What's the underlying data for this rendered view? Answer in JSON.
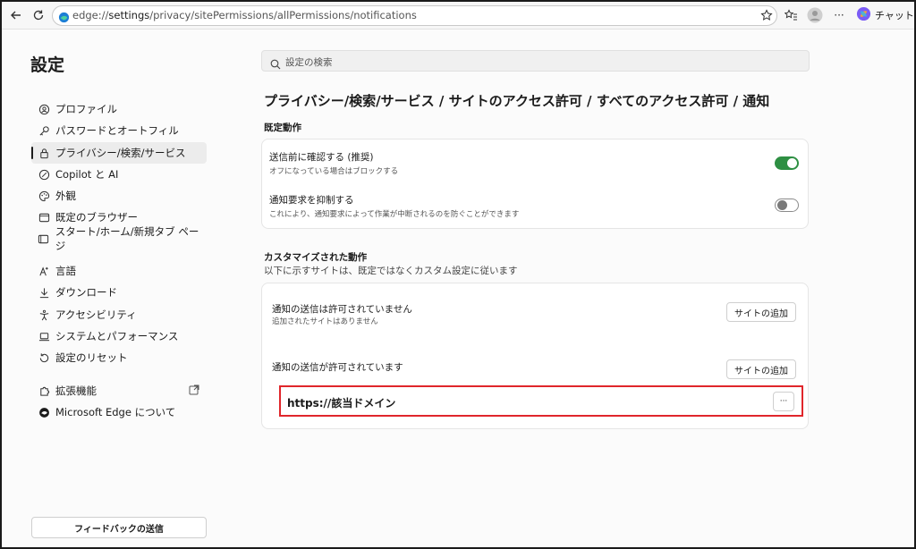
{
  "browser": {
    "url_prefix": "edge://",
    "url_host": "settings",
    "url_path": "/privacy/sitePermissions/allPermissions/notifications",
    "chat_label": "チャット"
  },
  "sidebar": {
    "title": "設定",
    "items": [
      {
        "label": "プロファイル",
        "icon": "profile-icon"
      },
      {
        "label": "パスワードとオートフィル",
        "icon": "key-icon"
      },
      {
        "label": "プライバシー/検索/サービス",
        "icon": "lock-icon",
        "active": true
      },
      {
        "label": "Copilot と AI",
        "icon": "copilot-icon"
      },
      {
        "label": "外観",
        "icon": "palette-icon"
      },
      {
        "label": "既定のブラウザー",
        "icon": "browser-icon"
      },
      {
        "label": "スタート/ホーム/新規タブ ページ",
        "icon": "home-icon"
      },
      {
        "label": "言語",
        "icon": "language-icon"
      },
      {
        "label": "ダウンロード",
        "icon": "download-icon"
      },
      {
        "label": "アクセシビリティ",
        "icon": "accessibility-icon"
      },
      {
        "label": "システムとパフォーマンス",
        "icon": "laptop-icon"
      },
      {
        "label": "設定のリセット",
        "icon": "reset-icon"
      },
      {
        "label": "拡張機能",
        "icon": "puzzle-icon"
      },
      {
        "label": "Microsoft Edge について",
        "icon": "edge-icon"
      }
    ],
    "feedback_label": "フィードバックの送信"
  },
  "search": {
    "placeholder": "設定の検索"
  },
  "breadcrumb": "プライバシー/検索/サービス / サイトのアクセス許可 / すべてのアクセス許可 / 通知",
  "default_behavior": {
    "title": "既定動作",
    "rows": [
      {
        "title": "送信前に確認する (推奨)",
        "desc": "オフになっている場合はブロックする",
        "toggle": "on"
      },
      {
        "title": "通知要求を抑制する",
        "desc": "これにより、通知要求によって作業が中断されるのを防ぐことができます",
        "toggle": "off"
      }
    ]
  },
  "custom_behavior": {
    "title": "カスタマイズされた動作",
    "subtitle": "以下に示すサイトは、既定ではなくカスタム設定に従います",
    "blocked": {
      "title": "通知の送信は許可されていません",
      "desc": "追加されたサイトはありません",
      "button": "サイトの追加"
    },
    "allowed": {
      "title": "通知の送信が許可されています",
      "button": "サイトの追加"
    },
    "site": {
      "name": "https://該当ドメイン",
      "more": "···"
    }
  },
  "colors": {
    "toggle_on": "#2e8f43",
    "highlight": "#e0262b"
  }
}
